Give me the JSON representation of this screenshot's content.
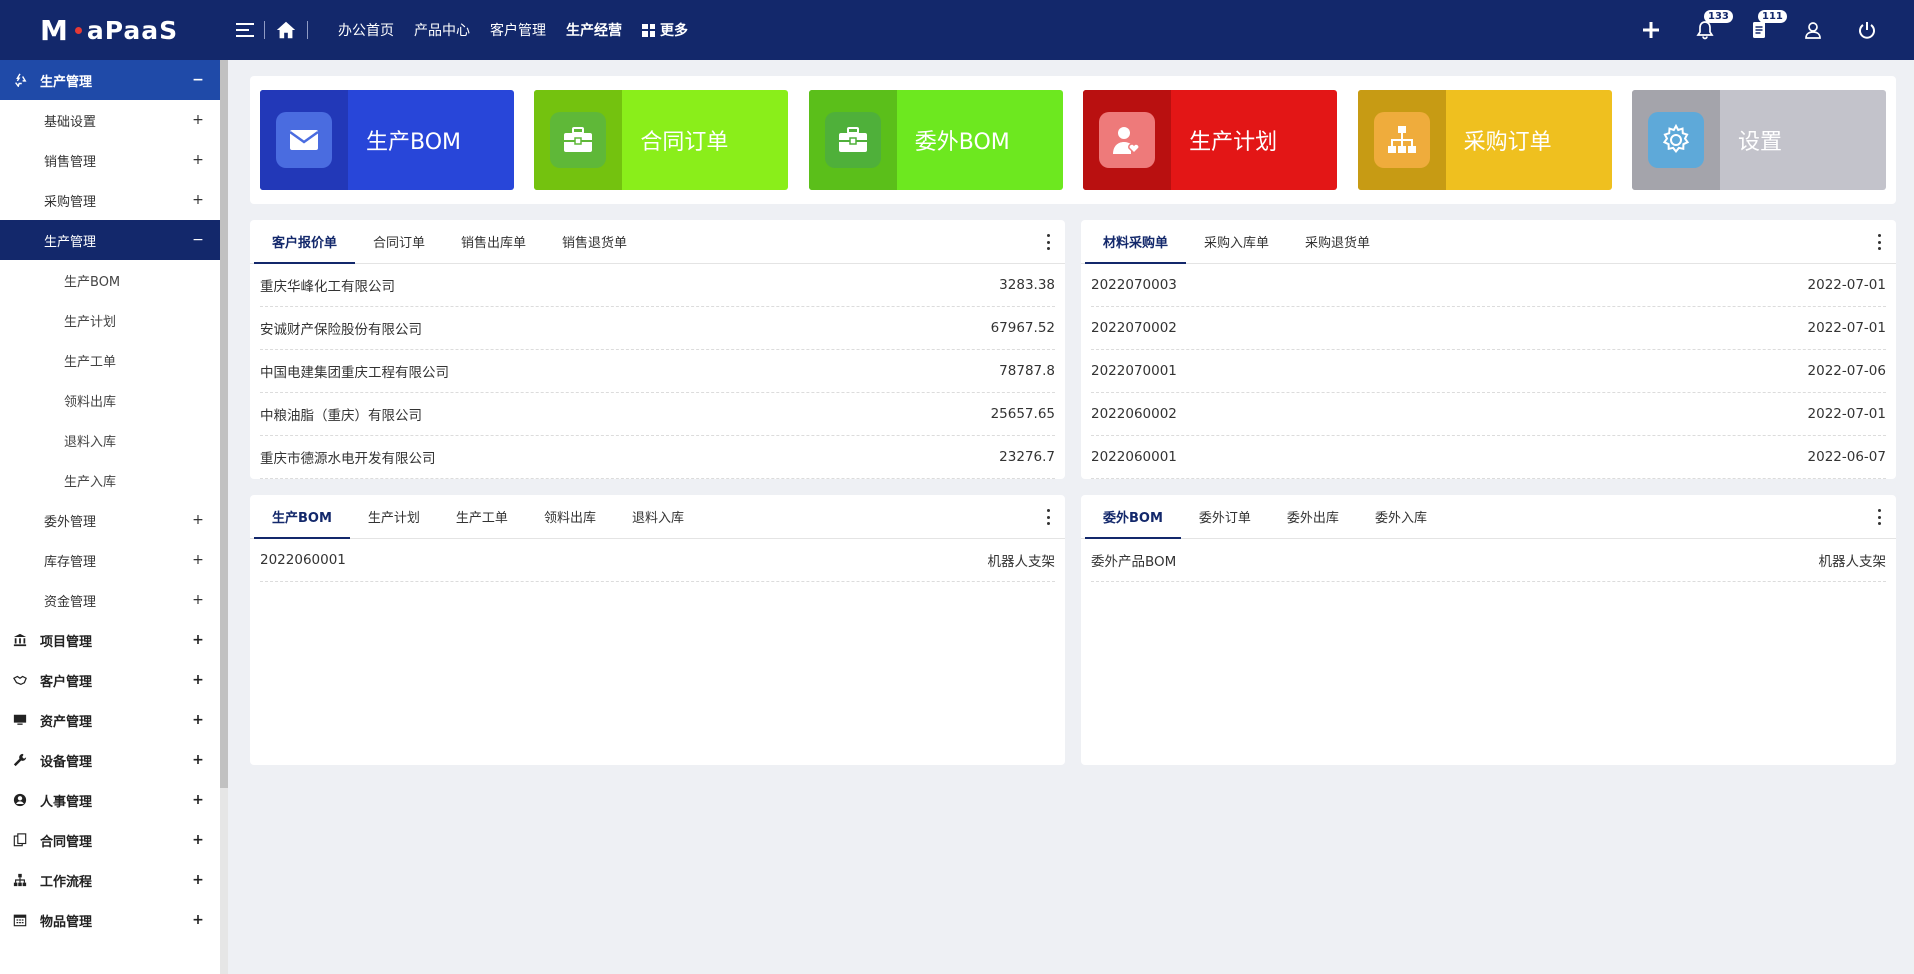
{
  "app": {
    "logo_m": "M",
    "logo_rest": "aPaaS"
  },
  "topnav": [
    {
      "label": "办公首页",
      "bold": false
    },
    {
      "label": "产品中心",
      "bold": false
    },
    {
      "label": "客户管理",
      "bold": false
    },
    {
      "label": "生产经营",
      "bold": true
    },
    {
      "label": "更多",
      "bold": true
    }
  ],
  "top_right": {
    "add_icon": "plus-icon",
    "notifications_count": "133",
    "messages_count": "111",
    "user_icon": "user-icon",
    "power_icon": "power-icon"
  },
  "sidebar": {
    "items": [
      {
        "label": "生产管理",
        "level": 1,
        "toggle": "−",
        "active": true,
        "icon": "recycle-icon"
      },
      {
        "label": "基础设置",
        "level": 2,
        "toggle": "+"
      },
      {
        "label": "销售管理",
        "level": 2,
        "toggle": "+"
      },
      {
        "label": "采购管理",
        "level": 2,
        "toggle": "+"
      },
      {
        "label": "生产管理",
        "level": 2,
        "toggle": "−",
        "active": true
      },
      {
        "label": "生产BOM",
        "level": 3
      },
      {
        "label": "生产计划",
        "level": 3
      },
      {
        "label": "生产工单",
        "level": 3
      },
      {
        "label": "领料出库",
        "level": 3
      },
      {
        "label": "退料入库",
        "level": 3
      },
      {
        "label": "生产入库",
        "level": 3
      },
      {
        "label": "委外管理",
        "level": 2,
        "toggle": "+"
      },
      {
        "label": "库存管理",
        "level": 2,
        "toggle": "+"
      },
      {
        "label": "资金管理",
        "level": 2,
        "toggle": "+"
      },
      {
        "label": "项目管理",
        "level": 1,
        "toggle": "+",
        "icon": "bank-icon"
      },
      {
        "label": "客户管理",
        "level": 1,
        "toggle": "+",
        "icon": "handshake-icon"
      },
      {
        "label": "资产管理",
        "level": 1,
        "toggle": "+",
        "icon": "monitor-icon"
      },
      {
        "label": "设备管理",
        "level": 1,
        "toggle": "+",
        "icon": "wrench-icon"
      },
      {
        "label": "人事管理",
        "level": 1,
        "toggle": "+",
        "icon": "user-circle-icon"
      },
      {
        "label": "合同管理",
        "level": 1,
        "toggle": "+",
        "icon": "copy-icon"
      },
      {
        "label": "工作流程",
        "level": 1,
        "toggle": "+",
        "icon": "sitemap-icon"
      },
      {
        "label": "物品管理",
        "level": 1,
        "toggle": "+",
        "icon": "calendar-icon"
      }
    ]
  },
  "quick_cards": [
    {
      "label": "生产BOM",
      "icon": "envelope-icon",
      "bg": "#2846d9",
      "icon_bg": "#2238b8",
      "sq": "#4a6ce0"
    },
    {
      "label": "合同订单",
      "icon": "briefcase-icon",
      "bg": "#8aee1a",
      "icon_bg": "#74c20f",
      "sq": "#5fb838"
    },
    {
      "label": "委外BOM",
      "icon": "briefcase-icon",
      "bg": "#6de81f",
      "icon_bg": "#5bbf1a",
      "sq": "#4fb03a"
    },
    {
      "label": "生产计划",
      "icon": "user-heart-icon",
      "bg": "#e31616",
      "icon_bg": "#b91010",
      "sq": "#ee7a7a"
    },
    {
      "label": "采购订单",
      "icon": "sitemap-icon",
      "bg": "#efc01f",
      "icon_bg": "#c79b14",
      "sq": "#efac3c"
    },
    {
      "label": "设置",
      "icon": "gear-icon",
      "bg": "#c3c3cb",
      "icon_bg": "#a4a4ab",
      "sq": "#5ea9d9"
    }
  ],
  "panels": {
    "sales": {
      "tabs": [
        "客户报价单",
        "合同订单",
        "销售出库单",
        "销售退货单"
      ],
      "rows": [
        {
          "name": "重庆华峰化工有限公司",
          "value": "3283.38"
        },
        {
          "name": "安诚财产保险股份有限公司",
          "value": "67967.52"
        },
        {
          "name": "中国电建集团重庆工程有限公司",
          "value": "78787.8"
        },
        {
          "name": "中粮油脂（重庆）有限公司",
          "value": "25657.65"
        },
        {
          "name": "重庆市德源水电开发有限公司",
          "value": "23276.7"
        }
      ]
    },
    "purchase": {
      "tabs": [
        "材料采购单",
        "采购入库单",
        "采购退货单"
      ],
      "rows": [
        {
          "name": "2022070003",
          "value": "2022-07-01"
        },
        {
          "name": "2022070002",
          "value": "2022-07-01"
        },
        {
          "name": "2022070001",
          "value": "2022-07-06"
        },
        {
          "name": "2022060002",
          "value": "2022-07-01"
        },
        {
          "name": "2022060001",
          "value": "2022-06-07"
        }
      ]
    },
    "production": {
      "tabs": [
        "生产BOM",
        "生产计划",
        "生产工单",
        "领料出库",
        "退料入库"
      ],
      "rows": [
        {
          "name": "2022060001",
          "value": "机器人支架"
        }
      ]
    },
    "outsource": {
      "tabs": [
        "委外BOM",
        "委外订单",
        "委外出库",
        "委外入库"
      ],
      "rows": [
        {
          "name": "委外产品BOM",
          "value": "机器人支架"
        }
      ]
    }
  }
}
